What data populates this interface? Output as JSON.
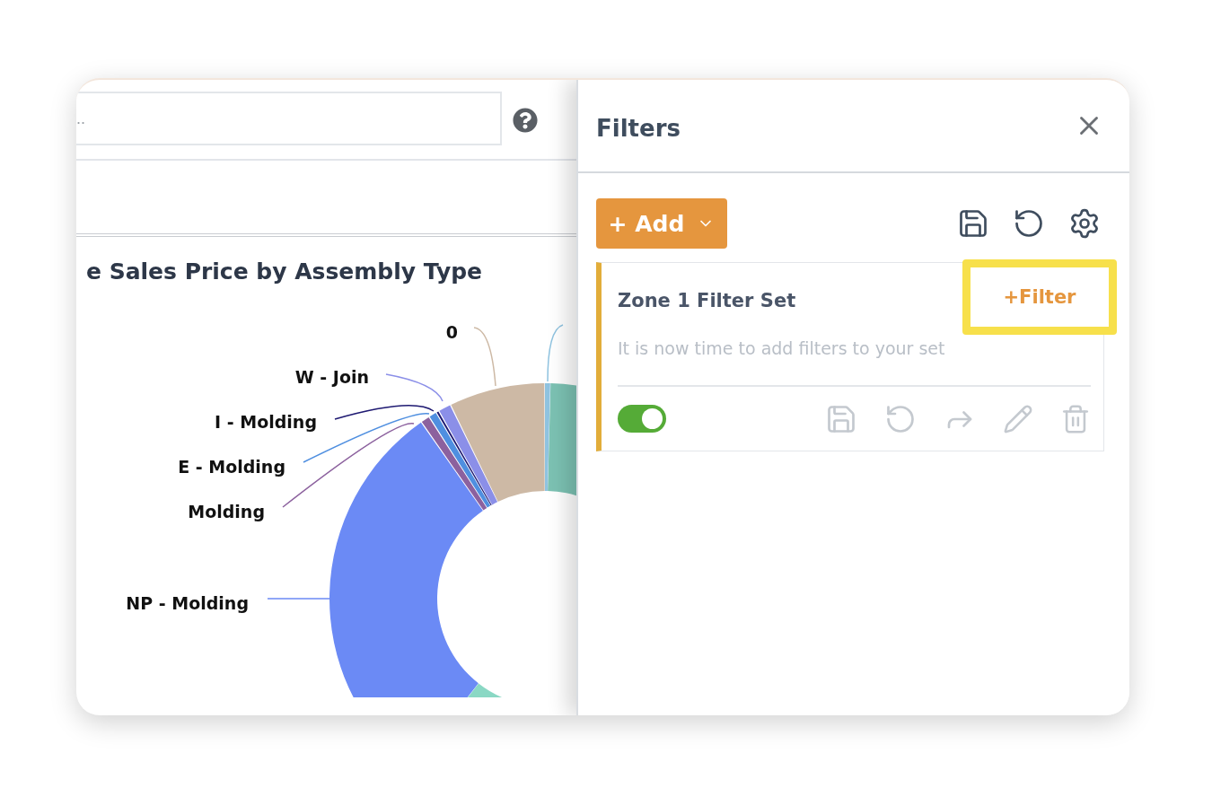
{
  "dashboard": {
    "search": {
      "placeholder": ".."
    },
    "chart_title": "e Sales Price by Assembly Type",
    "donut_chart": {
      "labels": [
        {
          "label": "0",
          "color": "#cdb9a5"
        },
        {
          "label": "W - Join",
          "color": "#8b8fe8"
        },
        {
          "label": "I - Molding",
          "color": "#1f1a72"
        },
        {
          "label": "E - Molding",
          "color": "#4f8fe0"
        },
        {
          "label": "Molding",
          "color": "#8c619e"
        },
        {
          "label": "NP - Molding",
          "color": "#6b8af5"
        }
      ]
    }
  },
  "filters_panel": {
    "title": "Filters",
    "add_button": "+ Add",
    "filter_set": {
      "title": "Zone 1 Filter Set",
      "add_filter_button": {
        "label": "+Filter",
        "highlighted": true
      },
      "description": "It is now time to add filters to your set",
      "enabled": true
    }
  }
}
